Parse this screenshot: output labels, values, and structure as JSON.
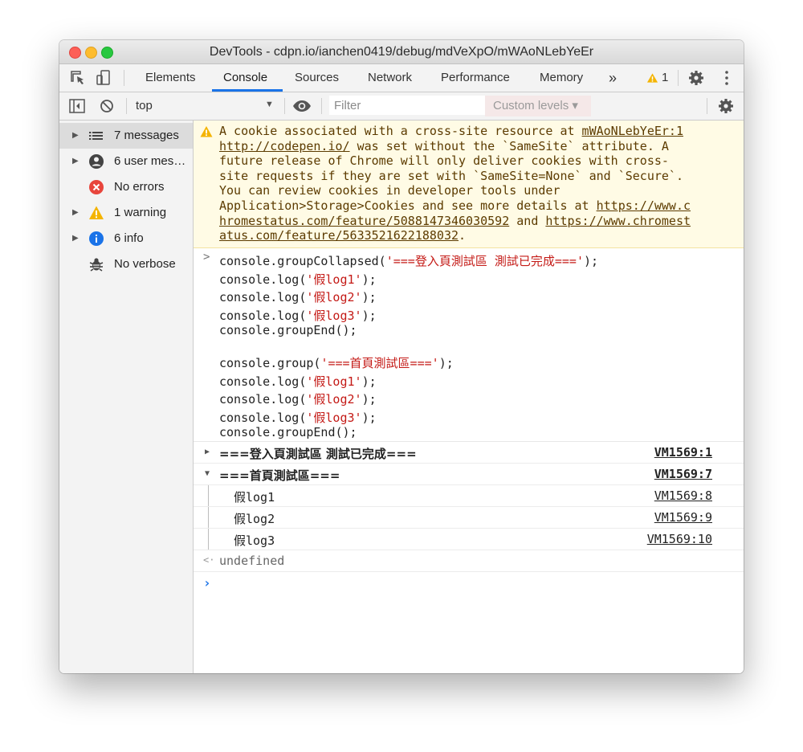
{
  "window": {
    "title": "DevTools - cdpn.io/ianchen0419/debug/mdVeXpO/mWAoNLebYeEr"
  },
  "tabs": [
    "Elements",
    "Console",
    "Sources",
    "Network",
    "Performance",
    "Memory"
  ],
  "tabbar": {
    "more": "»",
    "warning_count": "1"
  },
  "toolbar": {
    "context": "top",
    "filter_placeholder": "Filter",
    "levels": "Custom levels ▾"
  },
  "sidebar": {
    "items": [
      {
        "label": "7 messages",
        "icon": "list-icon"
      },
      {
        "label": "6 user mes…",
        "icon": "user-icon"
      },
      {
        "label": "No errors",
        "icon": "error-icon"
      },
      {
        "label": "1 warning",
        "icon": "warning-icon"
      },
      {
        "label": "6 info",
        "icon": "info-icon"
      },
      {
        "label": "No verbose",
        "icon": "bug-icon"
      }
    ]
  },
  "warning": {
    "source": "mWAoNLebYeEr:1",
    "line1_pre": "A cookie associated with a cross-site resource at ",
    "url1": "http://codepen.io/",
    "line2_post": " was set without the `SameSite` attribute. A",
    "line3": "future release of Chrome will only deliver cookies with cross-",
    "line4": "site requests if they are set with `SameSite=None` and `Secure`.",
    "line5": "You can review cookies in developer tools under",
    "line6_pre": "Application>Storage>Cookies and see more details at ",
    "url2a": "https://www.c",
    "url2b": "hromestatus.com/feature/5088147346030592",
    "and_word": " and ",
    "url3a": "https://www.chromest",
    "url3b": "atus.com/feature/5633521622188032",
    "period": "."
  },
  "code": {
    "l1_fn": "console.groupCollapsed(",
    "l1_str": "'===登入頁測試區 測試已完成==='",
    "l1_end": ");",
    "l2_fn": "console.log(",
    "l2_str": "'假log1'",
    "l2_end": ");",
    "l3_fn": "console.log(",
    "l3_str": "'假log2'",
    "l3_end": ");",
    "l4_fn": "console.log(",
    "l4_str": "'假log3'",
    "l4_end": ");",
    "l5": "console.groupEnd();",
    "l6_fn": "console.group(",
    "l6_str": "'===首頁測試區==='",
    "l6_end": ");",
    "l7_fn": "console.log(",
    "l7_str": "'假log1'",
    "l7_end": ");",
    "l8_fn": "console.log(",
    "l8_str": "'假log2'",
    "l8_end": ");",
    "l9_fn": "console.log(",
    "l9_str": "'假log3'",
    "l9_end": ");",
    "l10": "console.groupEnd();"
  },
  "groups": [
    {
      "label": "===登入頁測試區 測試已完成===",
      "link": "VM1569:1",
      "collapsed": true
    },
    {
      "label": "===首頁測試區===",
      "link": "VM1569:7",
      "collapsed": false
    }
  ],
  "logs": [
    {
      "text": "假log1",
      "link": "VM1569:8"
    },
    {
      "text": "假log2",
      "link": "VM1569:9"
    },
    {
      "text": "假log3",
      "link": "VM1569:10"
    }
  ],
  "result": "undefined",
  "colors": {
    "accent": "#1a73e8",
    "warning_bg": "#fffbe5",
    "warning_text": "#5c3b00",
    "string": "#c41a16"
  }
}
